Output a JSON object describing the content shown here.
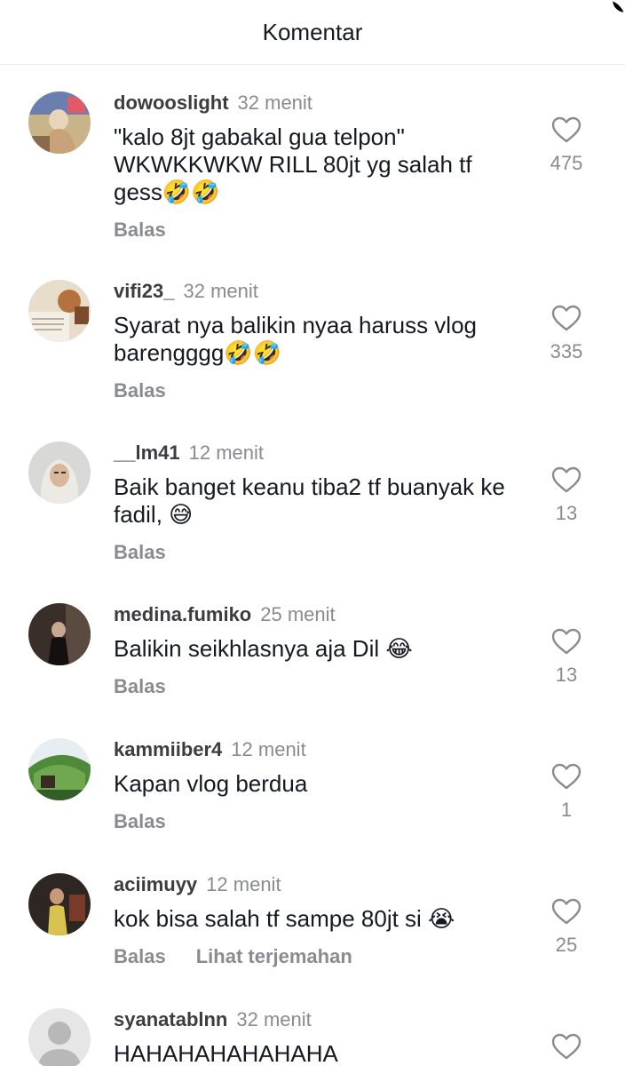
{
  "header": {
    "title": "Komentar"
  },
  "reply_label": "Balas",
  "comments": [
    {
      "username": "dowooslight",
      "time": "32 menit",
      "text": "\"kalo 8jt gabakal gua telpon\" WKWKKWKW RILL 80jt yg salah tf gess🤣🤣",
      "likes": "475",
      "actions": [
        "Balas"
      ]
    },
    {
      "username": "vifi23_",
      "time": "32 menit",
      "text": "Syarat nya balikin nyaa haruss vlog barengggg🤣🤣",
      "likes": "335",
      "actions": [
        "Balas"
      ]
    },
    {
      "username": "__lm41",
      "time": "12 menit",
      "text": "Baik banget keanu tiba2 tf buanyak ke fadil, 😅",
      "likes": "13",
      "actions": [
        "Balas"
      ]
    },
    {
      "username": "medina.fumiko",
      "time": "25 menit",
      "text": "Balikin seikhlasnya aja Dil 😂",
      "likes": "13",
      "actions": [
        "Balas"
      ]
    },
    {
      "username": "kammiiber4",
      "time": "12 menit",
      "text": "Kapan vlog berdua",
      "likes": "1",
      "actions": [
        "Balas"
      ]
    },
    {
      "username": "aciimuyy",
      "time": "12 menit",
      "text": "kok bisa salah tf sampe 80jt si 😭",
      "likes": "25",
      "actions": [
        "Balas",
        "Lihat terjemahan"
      ]
    },
    {
      "username": "syanatablnn",
      "time": "32 menit",
      "text": "HAHAHAHAHAHAHA",
      "likes": "",
      "actions": []
    }
  ]
}
